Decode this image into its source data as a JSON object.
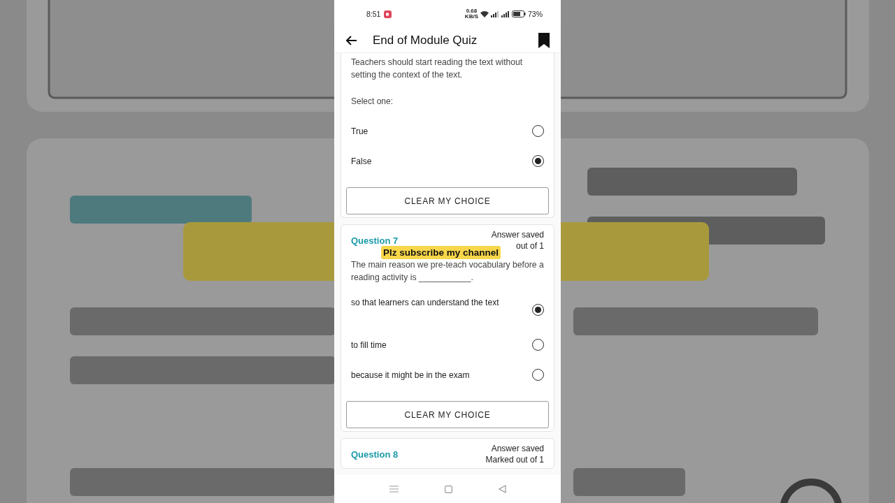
{
  "status_bar": {
    "time": "8:51",
    "speed": "0.68",
    "speed_unit": "KB/S",
    "battery": "73%"
  },
  "app_bar": {
    "title": "End of Module Quiz"
  },
  "questions": [
    {
      "partial": true,
      "text": "Teachers should start reading the text without setting the context of the text.",
      "prompt": "Select one:",
      "options": [
        {
          "label": "True",
          "selected": false
        },
        {
          "label": "False",
          "selected": true
        }
      ],
      "button": "CLEAR MY CHOICE"
    },
    {
      "partial": false,
      "title": "Question 7",
      "status": "Answer saved",
      "marks": "out of 1",
      "text": "The main reason we pre-teach vocabulary before a reading activity is ___________.",
      "options": [
        {
          "label": "so that learners can understand the text",
          "selected": true
        },
        {
          "label": "to fill time",
          "selected": false
        },
        {
          "label": "because it might be in the exam",
          "selected": false
        }
      ],
      "button": "CLEAR MY CHOICE"
    },
    {
      "partial": false,
      "title": "Question 8",
      "status": "Answer saved",
      "marks": "Marked out of 1"
    }
  ],
  "caption": "Plz subscribe my channel"
}
